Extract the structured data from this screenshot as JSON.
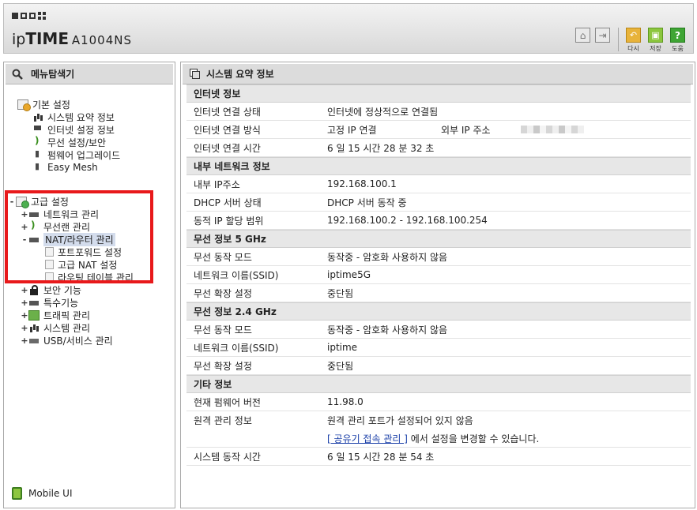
{
  "header": {
    "brand_ip": "ip",
    "brand_time": "TIME",
    "model": "A1004NS",
    "buttons": {
      "home_icon": "home-icon",
      "logout_icon": "logout-icon",
      "redo_label": "다시",
      "save_label": "저장",
      "help_label": "도움",
      "help_glyph": "?"
    }
  },
  "sidebar": {
    "title": "메뉴탐색기",
    "basic_settings": {
      "label": "기본 설정",
      "items": [
        {
          "label": "시스템 요약 정보",
          "icon": "chart-icon"
        },
        {
          "label": "인터넷 설정 정보",
          "icon": "monitor-icon"
        },
        {
          "label": "무선 설정/보안",
          "icon": "wireless-icon"
        },
        {
          "label": "펌웨어 업그레이드",
          "icon": "firmware-icon"
        },
        {
          "label": "Easy Mesh",
          "icon": "mesh-icon"
        }
      ]
    },
    "advanced_settings": {
      "label": "고급 설정",
      "toggle": "-",
      "items": [
        {
          "label": "네트워크 관리",
          "toggle": "+"
        },
        {
          "label": "무선랜 관리",
          "toggle": "+"
        },
        {
          "label": "NAT/라우터 관리",
          "toggle": "-",
          "children": [
            {
              "label": "포트포워드 설정"
            },
            {
              "label": "고급 NAT 설정"
            },
            {
              "label": "라우팅 테이블 관리"
            }
          ]
        },
        {
          "label": "보안 기능",
          "toggle": "+"
        },
        {
          "label": "특수기능",
          "toggle": "+"
        },
        {
          "label": "트래픽 관리",
          "toggle": "+"
        },
        {
          "label": "시스템 관리",
          "toggle": "+"
        },
        {
          "label": "USB/서비스 관리",
          "toggle": "+"
        }
      ]
    },
    "mobile_ui": "Mobile UI"
  },
  "main": {
    "title": "시스템 요약 정보",
    "internet": {
      "header": "인터넷 정보",
      "status_key": "인터넷 연결 상태",
      "status_value": "인터넷에 정상적으로 연결됨",
      "method_key": "인터넷 연결 방식",
      "method_value": "고정 IP 연결",
      "external_ip_label": "외부 IP 주소",
      "time_key": "인터넷 연결 시간",
      "time_value": "6 일 15 시간 28 분 32 초"
    },
    "lan": {
      "header": "내부 네트워크 정보",
      "ip_key": "내부 IP주소",
      "ip_value": "192.168.100.1",
      "dhcp_key": "DHCP 서버 상태",
      "dhcp_value": "DHCP 서버 동작 중",
      "range_key": "동적 IP 할당 범위",
      "range_value": "192.168.100.2 -  192.168.100.254"
    },
    "wifi5": {
      "header": "무선 정보 5 GHz",
      "mode_key": "무선 동작 모드",
      "mode_value": "동작중 - 암호화 사용하지 않음",
      "ssid_key": "네트워크 이름(SSID)",
      "ssid_value": "iptime5G",
      "ext_key": "무선 확장 설정",
      "ext_value": "중단됨"
    },
    "wifi24": {
      "header": "무선 정보 2.4 GHz",
      "mode_key": "무선 동작 모드",
      "mode_value": "동작중 - 암호화 사용하지 않음",
      "ssid_key": "네트워크 이름(SSID)",
      "ssid_value": "iptime",
      "ext_key": "무선 확장 설정",
      "ext_value": "중단됨"
    },
    "other": {
      "header": "기타 정보",
      "fw_key": "현재 펌웨어 버전",
      "fw_value": "11.98.0",
      "remote_key": "원격 관리 정보",
      "remote_value": "원격 관리 포트가 설정되어 있지 않음",
      "remote_link": "[ 공유기 접속 관리 ]",
      "remote_suffix": " 에서 설정을 변경할 수 있습니다.",
      "uptime_key": "시스템 동작 시간",
      "uptime_value": "6 일 15 시간 28 분 54 초"
    }
  }
}
